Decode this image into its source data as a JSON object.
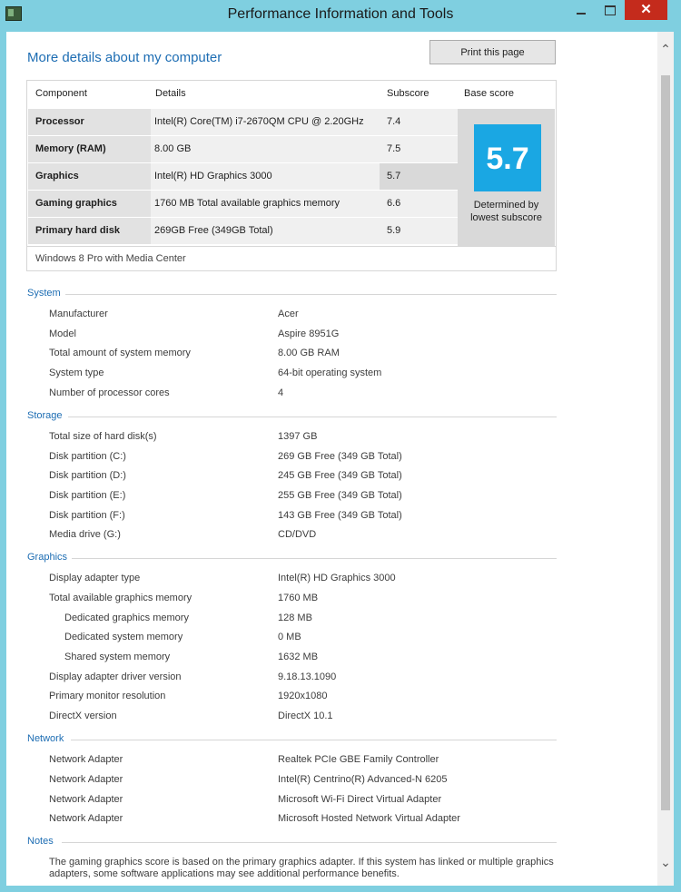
{
  "window": {
    "title": "Performance Information and Tools",
    "close_glyph": "✕"
  },
  "heading": "More details about my computer",
  "print_button": "Print this page",
  "score_table": {
    "headers": [
      "Component",
      "Details",
      "Subscore",
      "Base score"
    ],
    "rows": [
      {
        "component": "Processor",
        "details": "Intel(R) Core(TM) i7-2670QM CPU @ 2.20GHz",
        "subscore": "7.4"
      },
      {
        "component": "Memory (RAM)",
        "details": "8.00 GB",
        "subscore": "7.5"
      },
      {
        "component": "Graphics",
        "details": "Intel(R) HD Graphics 3000",
        "subscore": "5.7"
      },
      {
        "component": "Gaming graphics",
        "details": "1760 MB Total available graphics memory",
        "subscore": "6.6"
      },
      {
        "component": "Primary hard disk",
        "details": "269GB Free (349GB Total)",
        "subscore": "5.9"
      }
    ],
    "base_score": "5.7",
    "base_caption_1": "Determined by",
    "base_caption_2": "lowest subscore",
    "os": "Windows 8 Pro with Media Center",
    "accent": "#1aa7e3"
  },
  "sections": {
    "system": {
      "title": "System",
      "items": [
        {
          "k": "Manufacturer",
          "v": "Acer"
        },
        {
          "k": "Model",
          "v": "Aspire 8951G"
        },
        {
          "k": "Total amount of system memory",
          "v": "8.00 GB RAM"
        },
        {
          "k": "System type",
          "v": "64-bit operating system"
        },
        {
          "k": "Number of processor cores",
          "v": "4"
        }
      ]
    },
    "storage": {
      "title": "Storage",
      "items": [
        {
          "k": "Total size of hard disk(s)",
          "v": "1397 GB"
        },
        {
          "k": "Disk partition (C:)",
          "v": "269 GB Free (349 GB Total)"
        },
        {
          "k": "Disk partition (D:)",
          "v": "245 GB Free (349 GB Total)"
        },
        {
          "k": "Disk partition (E:)",
          "v": "255 GB Free (349 GB Total)"
        },
        {
          "k": "Disk partition (F:)",
          "v": "143 GB Free (349 GB Total)"
        },
        {
          "k": "Media drive (G:)",
          "v": "CD/DVD"
        }
      ]
    },
    "graphics": {
      "title": "Graphics",
      "items": [
        {
          "k": "Display adapter type",
          "v": "Intel(R) HD Graphics 3000"
        },
        {
          "k": "Total available graphics memory",
          "v": "1760 MB"
        },
        {
          "k": "Dedicated graphics memory",
          "v": "128 MB"
        },
        {
          "k": "Dedicated system memory",
          "v": "0 MB"
        },
        {
          "k": "Shared system memory",
          "v": "1632 MB"
        },
        {
          "k": "Display adapter driver version",
          "v": "9.18.13.1090"
        },
        {
          "k": "Primary monitor resolution",
          "v": "1920x1080"
        },
        {
          "k": "DirectX version",
          "v": "DirectX 10.1"
        }
      ]
    },
    "network": {
      "title": "Network",
      "items": [
        {
          "k": "Network Adapter",
          "v": "Realtek PCIe GBE Family Controller"
        },
        {
          "k": "Network Adapter",
          "v": "Intel(R) Centrino(R) Advanced-N 6205"
        },
        {
          "k": "Network Adapter",
          "v": "Microsoft Wi-Fi Direct Virtual Adapter"
        },
        {
          "k": "Network Adapter",
          "v": "Microsoft Hosted Network Virtual Adapter"
        }
      ]
    },
    "notes": {
      "title": "Notes",
      "text": "The gaming graphics score is based on the primary graphics adapter. If this system has linked or multiple graphics adapters, some software applications may see additional performance benefits."
    }
  },
  "icons": {
    "app": "performance-app-icon",
    "scroll_up": "chevron-up-icon",
    "scroll_down": "chevron-down-icon"
  }
}
